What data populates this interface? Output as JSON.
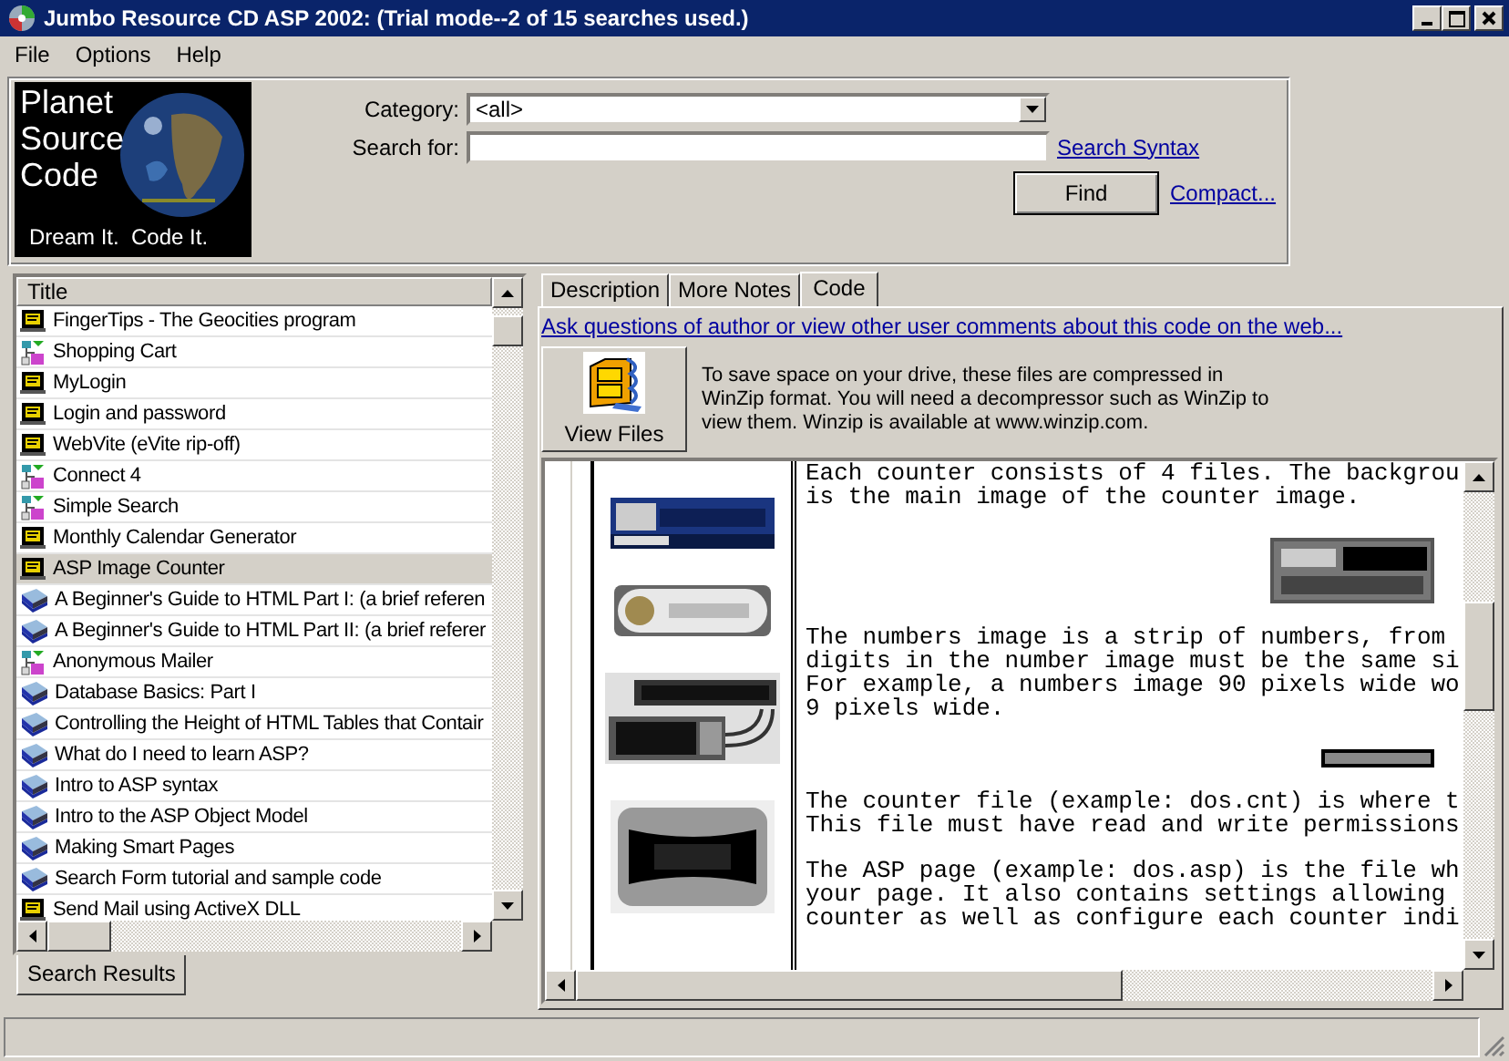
{
  "window": {
    "title": "Jumbo Resource CD ASP 2002: (Trial mode--2 of 15 searches used.)"
  },
  "menu": [
    "File",
    "Options",
    "Help"
  ],
  "logo": {
    "lines": [
      "Planet",
      "Source",
      "Code"
    ],
    "tagline": "Dream It.  Code It."
  },
  "search": {
    "category_label": "Category:",
    "category_value": "<all>",
    "search_label": "Search for:",
    "syntax_link": "Search Syntax",
    "find_button": "Find",
    "compact_link": "Compact..."
  },
  "results": {
    "header": "Title",
    "items": [
      {
        "title": "FingerTips - The Geocities program",
        "kind": "page",
        "selected": false
      },
      {
        "title": "Shopping Cart",
        "kind": "component",
        "selected": false
      },
      {
        "title": "MyLogin",
        "kind": "page",
        "selected": false
      },
      {
        "title": "Login and password",
        "kind": "page",
        "selected": false
      },
      {
        "title": "WebVite (eVite rip-off)",
        "kind": "page",
        "selected": false
      },
      {
        "title": "Connect 4",
        "kind": "component",
        "selected": false
      },
      {
        "title": "Simple Search",
        "kind": "component",
        "selected": false
      },
      {
        "title": "Monthly Calendar Generator",
        "kind": "page",
        "selected": false
      },
      {
        "title": "ASP Image Counter",
        "kind": "page",
        "selected": true
      },
      {
        "title": "A Beginner's Guide to HTML Part I: (a brief referen",
        "kind": "tutorial",
        "selected": false
      },
      {
        "title": "A Beginner's Guide to HTML Part II: (a brief referer",
        "kind": "tutorial",
        "selected": false
      },
      {
        "title": "Anonymous Mailer",
        "kind": "component",
        "selected": false
      },
      {
        "title": "Database Basics: Part I",
        "kind": "tutorial",
        "selected": false
      },
      {
        "title": "Controlling the Height of HTML Tables that Contair",
        "kind": "tutorial",
        "selected": false
      },
      {
        "title": "What do I need to learn ASP?",
        "kind": "tutorial",
        "selected": false
      },
      {
        "title": "Intro to ASP syntax",
        "kind": "tutorial",
        "selected": false
      },
      {
        "title": "Intro to the ASP Object Model",
        "kind": "tutorial",
        "selected": false
      },
      {
        "title": "Making Smart Pages",
        "kind": "tutorial",
        "selected": false
      },
      {
        "title": "Search Form tutorial and sample code",
        "kind": "tutorial",
        "selected": false
      },
      {
        "title": "Send Mail using ActiveX DLL",
        "kind": "page",
        "selected": false
      }
    ],
    "tab": "Search Results"
  },
  "detail": {
    "tabs": [
      {
        "label": "Description",
        "selected": false
      },
      {
        "label": "More Notes",
        "selected": false
      },
      {
        "label": "Code",
        "selected": true
      }
    ],
    "web_link": "Ask questions of author or view other user comments about this code on the web...",
    "view_files_button": "View Files",
    "zip_note": "To save space on your drive, these files are compressed in WinZip format.  You will need a decompressor such as WinZip to view them.  Winzip is available at www.winzip.com.",
    "code_blocks": [
      {
        "kind": "text",
        "lines": [
          "Each counter consists of 4 files. The backgrou",
          "is the main image of the counter image."
        ]
      },
      {
        "kind": "picture"
      },
      {
        "kind": "text",
        "lines": [
          "The numbers image is a strip of numbers, from",
          "digits in the number image must be the same si",
          "For example, a numbers image 90 pixels wide wo",
          "9 pixels wide."
        ]
      },
      {
        "kind": "picture"
      },
      {
        "kind": "text",
        "lines": [
          "The counter file (example: dos.cnt) is where t",
          "This file must have read and write permissions"
        ]
      },
      {
        "kind": "text",
        "lines": [
          "The ASP page (example: dos.asp) is the file wh",
          "your page. It also contains settings allowing",
          "counter as well as configure each counter indi"
        ]
      }
    ]
  }
}
